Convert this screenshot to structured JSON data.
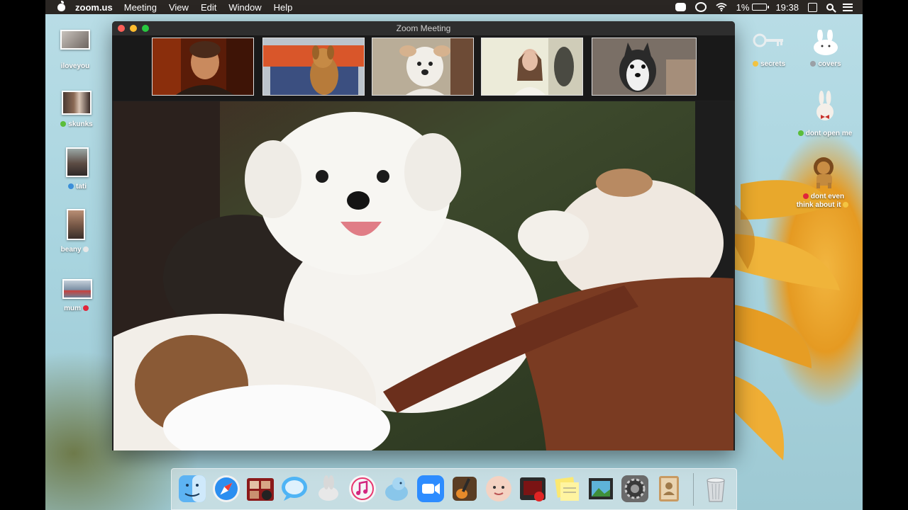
{
  "menubar": {
    "app_name": "zoom.us",
    "menus": [
      "Meeting",
      "View",
      "Edit",
      "Window",
      "Help"
    ],
    "battery": "1%",
    "time": "19:38",
    "status_icons": [
      "zoom-icon",
      "creative-cloud-icon",
      "wifi-icon",
      "battery-icon",
      "calendar-icon",
      "spotlight-search-icon",
      "notification-center-icon"
    ]
  },
  "desktop": {
    "left_items": [
      {
        "label": "iloveyou",
        "tag": ""
      },
      {
        "label": "skunks",
        "tag": "green-heart"
      },
      {
        "label": "tati",
        "tag": "wave"
      },
      {
        "label": "beany",
        "tag": "skull"
      },
      {
        "label": "mum",
        "tag": "red-heart"
      }
    ],
    "right_items": [
      {
        "label": "secrets",
        "tag": "worried-face",
        "icon": "key-icon"
      },
      {
        "label": "covers",
        "tag": "grey-dot",
        "icon": "bunny-icon"
      },
      {
        "label": "dont open me",
        "tag": "green-dot",
        "icon": "bunny-bowtie-icon"
      },
      {
        "label_line1": "dont even",
        "label_line2": "think about it",
        "tag": "red-dot",
        "tag2": "shushing-face",
        "icon": "lion-icon"
      }
    ]
  },
  "zoom_window": {
    "title": "Zoom Meeting",
    "gallery": [
      "man-participant",
      "brown-dog-participant",
      "white-dog-participant",
      "woman-participant",
      "husky-participant"
    ],
    "active_speaker": "white-maltese-dog"
  },
  "dock": {
    "apps": [
      "finder-icon",
      "safari-icon",
      "photo-booth-icon",
      "messages-icon",
      "inkscape-icon",
      "itunes-icon",
      "seal-app-icon",
      "zoom-icon",
      "garageband-icon",
      "face-app-icon",
      "photo-app-icon",
      "stickies-icon",
      "preview-icon",
      "system-preferences-icon",
      "contacts-icon",
      "trash-icon"
    ]
  },
  "colors": {
    "menubar_bg": "#2a2623",
    "window_bg": "#1f1f1f",
    "traffic_red": "#fd5f57",
    "traffic_yellow": "#febc2e",
    "traffic_green": "#28c840",
    "desktop_sky": "#a8d4df",
    "sunflower": "#e59a22"
  }
}
